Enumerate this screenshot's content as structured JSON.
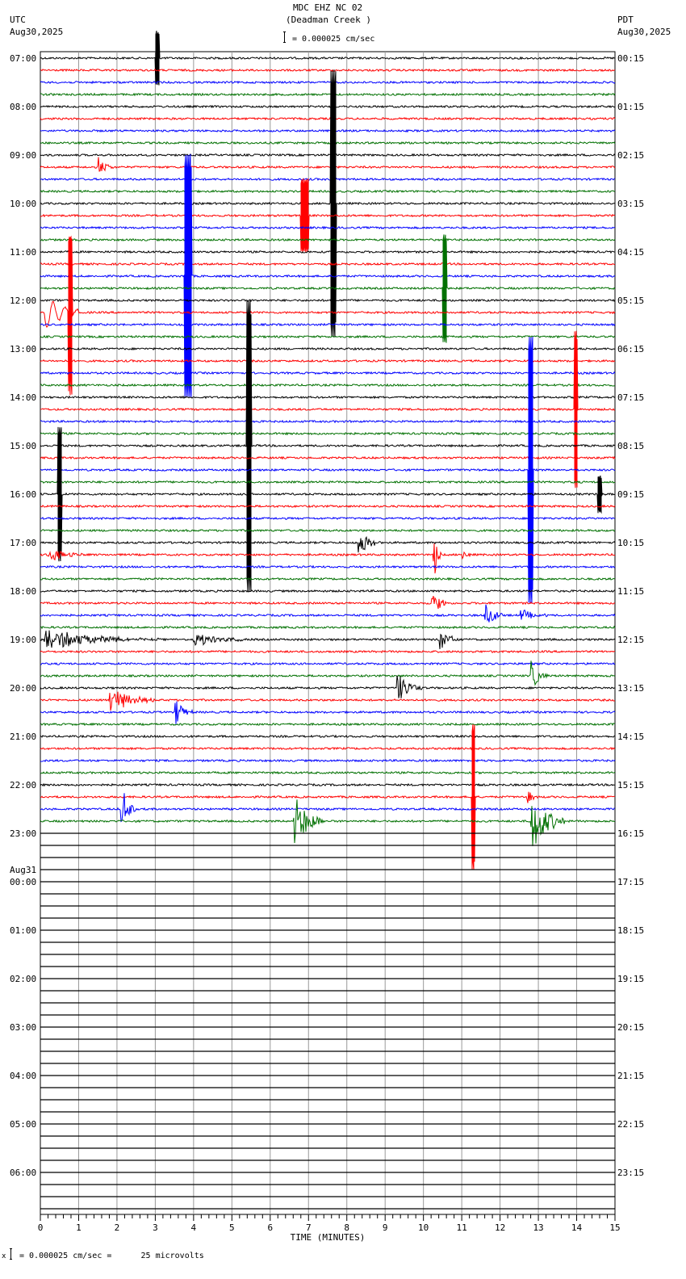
{
  "header": {
    "station": "MDC EHZ NC 02",
    "location": "(Deadman Creek )",
    "left_tz": "UTC",
    "left_date": "Aug30,2025",
    "right_tz": "PDT",
    "right_date": "Aug30,2025",
    "scale": "= 0.000025 cm/sec"
  },
  "footer": {
    "scale_note": "= 0.000025 cm/sec =      25 microvolts",
    "scale_prefix": "x"
  },
  "chart_data": {
    "type": "line",
    "title": "MDC EHZ NC 02 (Deadman Creek )",
    "xlabel": "TIME (MINUTES)",
    "xlim": [
      0,
      15
    ],
    "x_ticks": [
      "0",
      "1",
      "2",
      "3",
      "4",
      "5",
      "6",
      "7",
      "8",
      "9",
      "10",
      "11",
      "12",
      "13",
      "14",
      "15"
    ],
    "traces_per_hour": 4,
    "total_traces": 96,
    "recorded_traces": 64,
    "trace_colors": [
      "#000000",
      "#ff0000",
      "#0000ff",
      "#007000"
    ],
    "left_labels": [
      {
        "trace": 0,
        "text": "07:00"
      },
      {
        "trace": 4,
        "text": "08:00"
      },
      {
        "trace": 8,
        "text": "09:00"
      },
      {
        "trace": 12,
        "text": "10:00"
      },
      {
        "trace": 16,
        "text": "11:00"
      },
      {
        "trace": 20,
        "text": "12:00"
      },
      {
        "trace": 24,
        "text": "13:00"
      },
      {
        "trace": 28,
        "text": "14:00"
      },
      {
        "trace": 32,
        "text": "15:00"
      },
      {
        "trace": 36,
        "text": "16:00"
      },
      {
        "trace": 40,
        "text": "17:00"
      },
      {
        "trace": 44,
        "text": "18:00"
      },
      {
        "trace": 48,
        "text": "19:00"
      },
      {
        "trace": 52,
        "text": "20:00"
      },
      {
        "trace": 56,
        "text": "21:00"
      },
      {
        "trace": 60,
        "text": "22:00"
      },
      {
        "trace": 64,
        "text": "23:00"
      },
      {
        "trace": 68,
        "text": "00:00",
        "date": "Aug31"
      },
      {
        "trace": 72,
        "text": "01:00"
      },
      {
        "trace": 76,
        "text": "02:00"
      },
      {
        "trace": 80,
        "text": "03:00"
      },
      {
        "trace": 84,
        "text": "04:00"
      },
      {
        "trace": 88,
        "text": "05:00"
      },
      {
        "trace": 92,
        "text": "06:00"
      }
    ],
    "right_labels": [
      "00:15",
      "01:15",
      "02:15",
      "03:15",
      "04:15",
      "05:15",
      "06:15",
      "07:15",
      "08:15",
      "09:15",
      "10:15",
      "11:15",
      "12:15",
      "13:15",
      "14:15",
      "15:15",
      "16:15",
      "17:15",
      "18:15",
      "19:15",
      "20:15",
      "21:15",
      "22:15",
      "23:15"
    ],
    "events": [
      {
        "trace": 0,
        "t": 3.05,
        "amp": 2.2,
        "dur": 0.05,
        "kind": "spike"
      },
      {
        "trace": 12,
        "t": 7.65,
        "amp": 11,
        "dur": 0.08,
        "kind": "spike"
      },
      {
        "trace": 18,
        "t": 3.85,
        "amp": 10,
        "dur": 0.1,
        "kind": "spike"
      },
      {
        "trace": 9,
        "t": 1.5,
        "amp": 1.0,
        "dur": 0.4,
        "kind": "burst"
      },
      {
        "trace": 21,
        "t": 0.1,
        "amp": 5,
        "dur": 0.9,
        "kind": "wave"
      },
      {
        "trace": 21,
        "t": 0.78,
        "amp": 6.5,
        "dur": 0.06,
        "kind": "spike"
      },
      {
        "trace": 13,
        "t": 6.9,
        "amp": 3,
        "dur": 0.1,
        "kind": "spike"
      },
      {
        "trace": 19,
        "t": 10.55,
        "amp": 4.5,
        "dur": 0.05,
        "kind": "spike"
      },
      {
        "trace": 32,
        "t": 5.44,
        "amp": 12,
        "dur": 0.06,
        "kind": "spike"
      },
      {
        "trace": 34,
        "t": 12.8,
        "amp": 11,
        "dur": 0.06,
        "kind": "spike"
      },
      {
        "trace": 29,
        "t": 13.98,
        "amp": 6.5,
        "dur": 0.05,
        "kind": "spike"
      },
      {
        "trace": 36,
        "t": 0.5,
        "amp": 5.5,
        "dur": 0.05,
        "kind": "spike"
      },
      {
        "trace": 36,
        "t": 14.6,
        "amp": 1.5,
        "dur": 0.05,
        "kind": "spike"
      },
      {
        "trace": 40,
        "t": 8.3,
        "amp": 1.2,
        "dur": 0.6,
        "kind": "burst"
      },
      {
        "trace": 41,
        "t": 0.2,
        "amp": 0.6,
        "dur": 1.0,
        "kind": "burst"
      },
      {
        "trace": 41,
        "t": 10.25,
        "amp": 3,
        "dur": 0.2,
        "kind": "burst"
      },
      {
        "trace": 41,
        "t": 11.0,
        "amp": 0.8,
        "dur": 0.3,
        "kind": "burst"
      },
      {
        "trace": 45,
        "t": 10.2,
        "amp": 1.2,
        "dur": 0.5,
        "kind": "burst"
      },
      {
        "trace": 46,
        "t": 11.6,
        "amp": 1.2,
        "dur": 0.5,
        "kind": "burst"
      },
      {
        "trace": 46,
        "t": 12.5,
        "amp": 0.6,
        "dur": 0.8,
        "kind": "burst"
      },
      {
        "trace": 48,
        "t": 0.1,
        "amp": 0.9,
        "dur": 3.0,
        "kind": "burst"
      },
      {
        "trace": 48,
        "t": 4.0,
        "amp": 0.6,
        "dur": 1.4,
        "kind": "burst"
      },
      {
        "trace": 48,
        "t": 10.4,
        "amp": 1.2,
        "dur": 0.5,
        "kind": "burst"
      },
      {
        "trace": 51,
        "t": 12.8,
        "amp": 1.3,
        "dur": 0.5,
        "kind": "burst"
      },
      {
        "trace": 52,
        "t": 9.3,
        "amp": 1.4,
        "dur": 0.7,
        "kind": "burst"
      },
      {
        "trace": 53,
        "t": 1.8,
        "amp": 1.2,
        "dur": 1.2,
        "kind": "burst"
      },
      {
        "trace": 54,
        "t": 3.5,
        "amp": 1.3,
        "dur": 0.5,
        "kind": "burst"
      },
      {
        "trace": 61,
        "t": 11.3,
        "amp": 6,
        "dur": 0.05,
        "kind": "spike"
      },
      {
        "trace": 61,
        "t": 12.7,
        "amp": 0.8,
        "dur": 0.3,
        "kind": "burst"
      },
      {
        "trace": 62,
        "t": 2.1,
        "amp": 2.5,
        "dur": 0.4,
        "kind": "burst"
      },
      {
        "trace": 63,
        "t": 6.6,
        "amp": 2.5,
        "dur": 0.8,
        "kind": "burst"
      },
      {
        "trace": 63,
        "t": 12.8,
        "amp": 2.8,
        "dur": 0.9,
        "kind": "burst"
      }
    ]
  }
}
